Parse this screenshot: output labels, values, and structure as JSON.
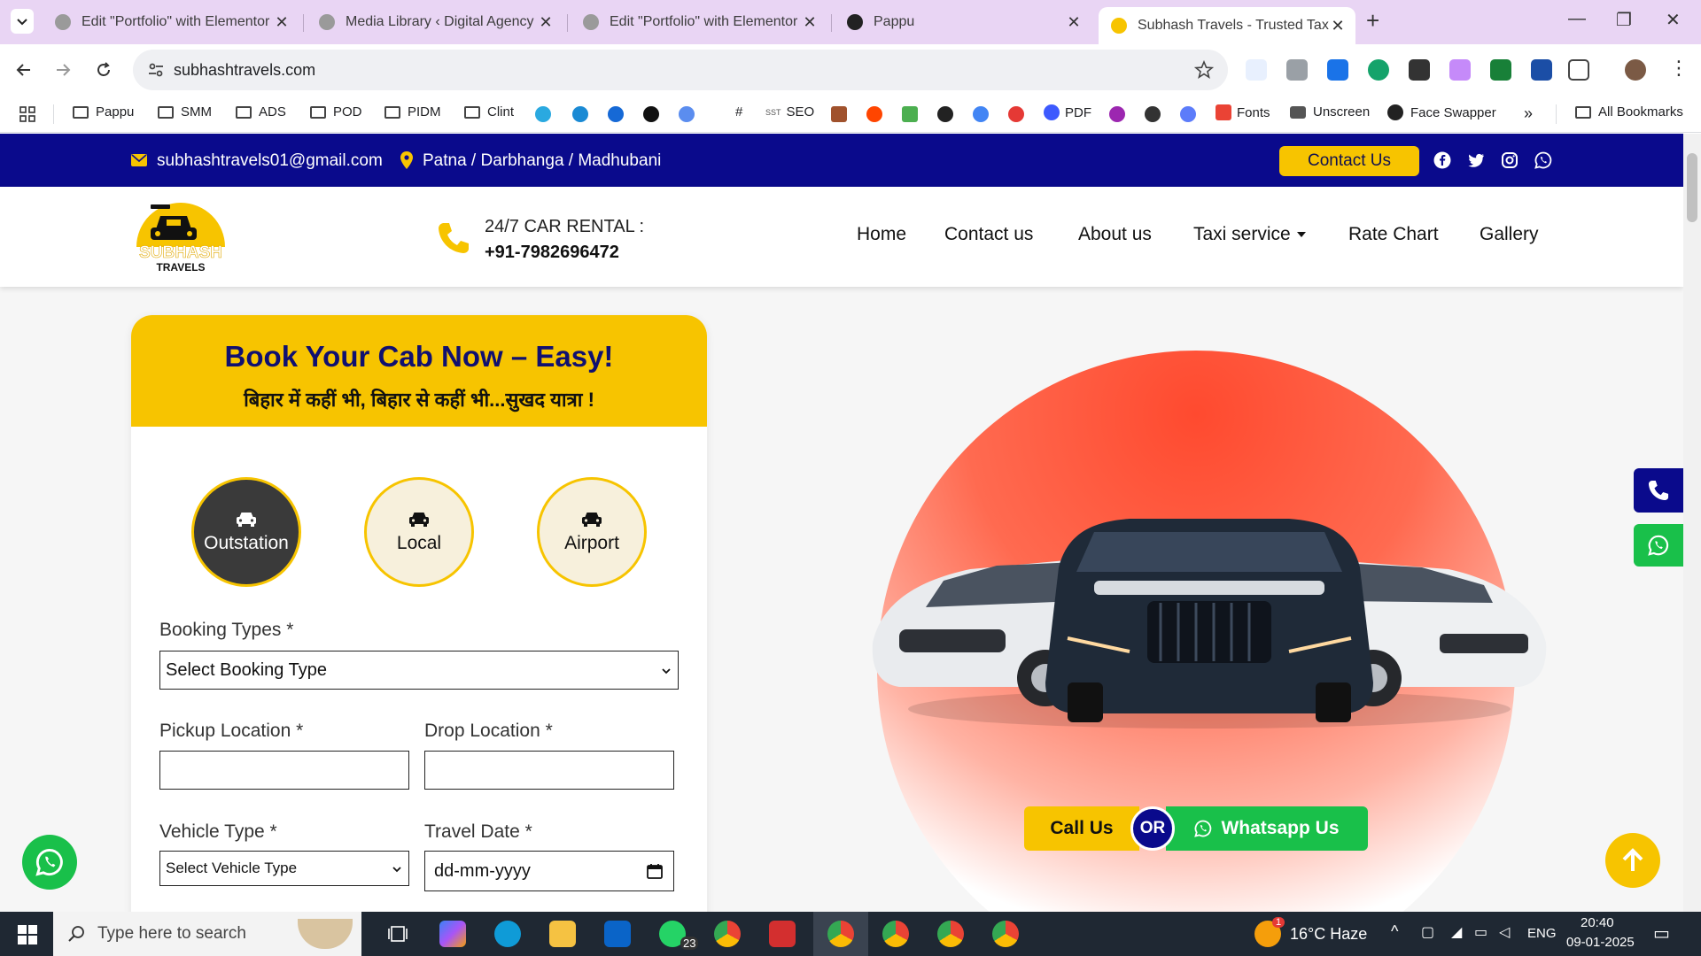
{
  "browser": {
    "tabs": [
      {
        "title": "Edit \"Portfolio\" with Elementor",
        "fav": "#777"
      },
      {
        "title": "Media Library ‹ Digital Agency –",
        "fav": "#777"
      },
      {
        "title": "Edit \"Portfolio\" with Elementor",
        "fav": "#777"
      },
      {
        "title": "Pappu",
        "fav": "#222"
      },
      {
        "title": "Subhash Travels - Trusted Taxi &",
        "fav": "#f7c400"
      }
    ],
    "url": "subhashtravels.com"
  },
  "bookmarks": {
    "items": [
      "Pappu",
      "SMM",
      "ADS",
      "POD",
      "PIDM",
      "Clint",
      "#",
      "SEO",
      "PDF",
      "Fonts",
      "Unscreen",
      "Face Swapper",
      "All Bookmarks"
    ],
    "sst_label": "SST",
    "more": "»"
  },
  "site": {
    "topbar": {
      "email": "subhashtravels01@gmail.com",
      "location": "Patna / Darbhanga / Madhubani",
      "contact_button": "Contact Us"
    },
    "logo": {
      "line1": "SUBHASH",
      "line2": "TRAVELS"
    },
    "header": {
      "rental_title": "24/7 CAR RENTAL :",
      "rental_phone": "+91-7982696472",
      "nav": [
        "Home",
        "Contact us",
        "About us",
        "Taxi service",
        "Rate Chart",
        "Gallery"
      ]
    },
    "booking": {
      "title": "Book Your Cab Now – Easy!",
      "subtitle": "बिहार में कहीं भी, बिहार से कहीं भी...सुखद यात्रा !",
      "trip_types": [
        "Outstation",
        "Local",
        "Airport"
      ],
      "booking_type_label": "Booking Types *",
      "booking_type_value": "Select Booking Type",
      "pickup_label": "Pickup Location *",
      "drop_label": "Drop Location *",
      "vehicle_label": "Vehicle Type *",
      "vehicle_value": "Select Vehicle Type",
      "date_label": "Travel Date *",
      "date_value": "dd-mm-yyyy"
    },
    "cta": {
      "call": "Call Us",
      "or": "OR",
      "whatsapp": "Whatsapp Us"
    }
  },
  "taskbar": {
    "search_placeholder": "Type here to search",
    "weather": "16°C  Haze",
    "lang": "ENG",
    "time": "20:40",
    "date": "09-01-2025",
    "whatsapp_badge": "23",
    "weather_badge": "1"
  },
  "colors": {
    "brand_blue": "#0a0a8c",
    "brand_yellow": "#f7c400",
    "whatsapp_green": "#19c04a",
    "tab_strip": "#e9d5f4"
  }
}
